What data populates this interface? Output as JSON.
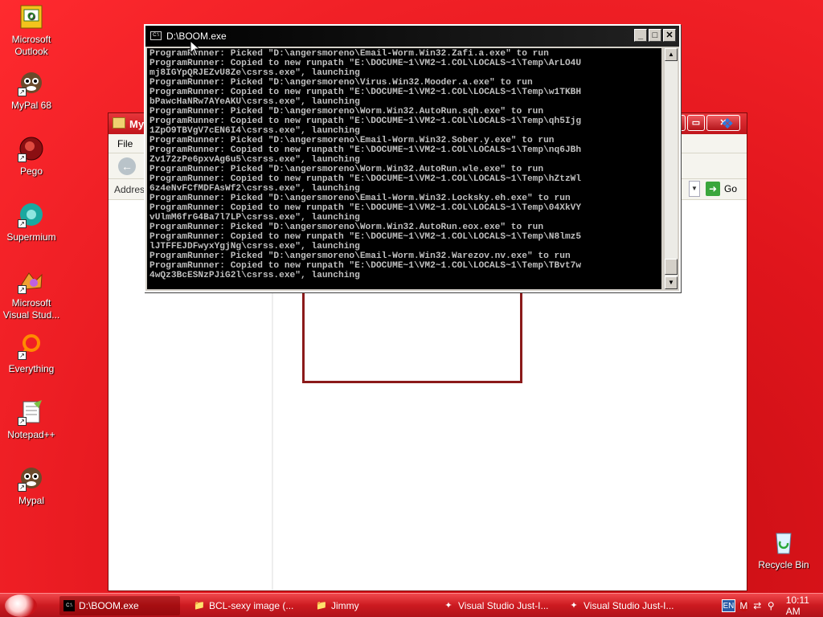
{
  "desktop": {
    "icons": [
      {
        "label": "Microsoft\nOutlook",
        "icon": "outlook-icon"
      },
      {
        "label": "MyPal 68",
        "icon": "mypal-icon"
      },
      {
        "label": "Pego",
        "icon": "pego-icon"
      },
      {
        "label": "Supermium",
        "icon": "supermium-icon"
      },
      {
        "label": "Microsoft\nVisual Stud...",
        "icon": "visual-studio-icon"
      },
      {
        "label": "Everything",
        "icon": "everything-icon"
      },
      {
        "label": "Notepad++",
        "icon": "notepadpp-icon"
      },
      {
        "label": "Mypal",
        "icon": "mypal-icon"
      },
      {
        "label": "Recycle Bin",
        "icon": "recycle-bin-icon"
      }
    ]
  },
  "explorer": {
    "title": "My",
    "menu_file": "File",
    "address_label": "Addres",
    "go_label": "Go"
  },
  "console": {
    "title": "D:\\BOOM.exe",
    "lines": [
      "ProgramRunner: Picked \"D:\\angersmoreno\\Email-Worm.Win32.Zafi.a.exe\" to run",
      "ProgramRunner: Copied to new runpath \"E:\\DOCUME~1\\VM2~1.COL\\LOCALS~1\\Temp\\ArLO4U",
      "mj8IGYpQRJEZvU8Ze\\csrss.exe\", launching",
      "ProgramRunner: Picked \"D:\\angersmoreno\\Virus.Win32.Mooder.a.exe\" to run",
      "ProgramRunner: Copied to new runpath \"E:\\DOCUME~1\\VM2~1.COL\\LOCALS~1\\Temp\\w1TKBH",
      "bPawcHaNRw7AYeAKU\\csrss.exe\", launching",
      "ProgramRunner: Picked \"D:\\angersmoreno\\Worm.Win32.AutoRun.sqh.exe\" to run",
      "ProgramRunner: Copied to new runpath \"E:\\DOCUME~1\\VM2~1.COL\\LOCALS~1\\Temp\\qh5Ijg",
      "1ZpO9TBVgV7cEN6I4\\csrss.exe\", launching",
      "ProgramRunner: Picked \"D:\\angersmoreno\\Email-Worm.Win32.Sober.y.exe\" to run",
      "ProgramRunner: Copied to new runpath \"E:\\DOCUME~1\\VM2~1.COL\\LOCALS~1\\Temp\\nq6JBh",
      "Zv172zPe6pxvAg6u5\\csrss.exe\", launching",
      "ProgramRunner: Picked \"D:\\angersmoreno\\Worm.Win32.AutoRun.wle.exe\" to run",
      "ProgramRunner: Copied to new runpath \"E:\\DOCUME~1\\VM2~1.COL\\LOCALS~1\\Temp\\hZtzWl",
      "6z4eNvFCfMDFAsWf2\\csrss.exe\", launching",
      "ProgramRunner: Picked \"D:\\angersmoreno\\Email-Worm.Win32.Locksky.eh.exe\" to run",
      "ProgramRunner: Copied to new runpath \"E:\\DOCUME~1\\VM2~1.COL\\LOCALS~1\\Temp\\04XkVY",
      "vUlmM6frG4Ba7l7LP\\csrss.exe\", launching",
      "ProgramRunner: Picked \"D:\\angersmoreno\\Worm.Win32.AutoRun.eox.exe\" to run",
      "ProgramRunner: Copied to new runpath \"E:\\DOCUME~1\\VM2~1.COL\\LOCALS~1\\Temp\\N8lmz5",
      "lJTFFEJDFwyxYgjNg\\csrss.exe\", launching",
      "ProgramRunner: Picked \"D:\\angersmoreno\\Email-Worm.Win32.Warezov.nv.exe\" to run",
      "ProgramRunner: Copied to new runpath \"E:\\DOCUME~1\\VM2~1.COL\\LOCALS~1\\Temp\\TBvt7w",
      "4wQz3BcESNzPJiG2l\\csrss.exe\", launching"
    ]
  },
  "taskbar": {
    "tasks": [
      {
        "label": "D:\\BOOM.exe",
        "icon": "console-icon",
        "active": true
      },
      {
        "label": "BCL-sexy image (...",
        "icon": "folder-icon",
        "active": false
      },
      {
        "label": "Jimmy",
        "icon": "folder-icon",
        "active": false
      },
      {
        "label": "Visual Studio Just-I...",
        "icon": "visual-studio-icon",
        "active": false
      },
      {
        "label": "Visual Studio Just-I...",
        "icon": "visual-studio-icon",
        "active": false
      }
    ],
    "language": "EN",
    "clock": "10:11 AM"
  },
  "colors": {
    "desktop_red": "#e0151c",
    "console_bg": "#000000",
    "console_text": "#c0c0c0",
    "taskbar_red": "#cc1a20"
  }
}
